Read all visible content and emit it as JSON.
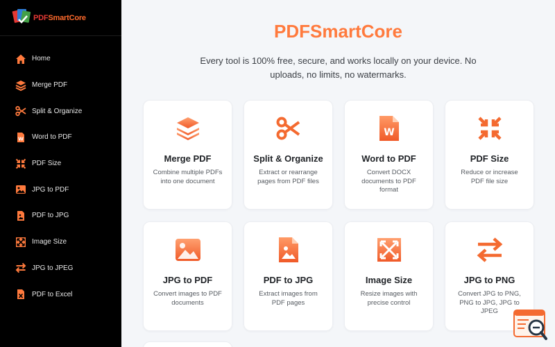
{
  "brand": {
    "name_part1": "PDF",
    "name_part2": "SmartCore"
  },
  "nav": [
    {
      "label": "Home",
      "icon": "home-icon"
    },
    {
      "label": "Merge PDF",
      "icon": "layers-icon"
    },
    {
      "label": "Split & Organize",
      "icon": "scissors-icon"
    },
    {
      "label": "Word to PDF",
      "icon": "word-file-icon"
    },
    {
      "label": "PDF Size",
      "icon": "compress-icon"
    },
    {
      "label": "JPG to PDF",
      "icon": "image-icon"
    },
    {
      "label": "PDF to JPG",
      "icon": "image-file-icon"
    },
    {
      "label": "Image Size",
      "icon": "expand-icon"
    },
    {
      "label": "JPG to JPEG",
      "icon": "swap-icon"
    },
    {
      "label": "PDF to Excel",
      "icon": "excel-file-icon"
    }
  ],
  "main": {
    "title": "PDFSmartCore",
    "subtitle": "Every tool is 100% free, secure, and works locally on your device. No uploads, no limits, no watermarks."
  },
  "cards": [
    {
      "title": "Merge PDF",
      "desc": "Combine multiple PDFs into one document",
      "icon": "layers-icon"
    },
    {
      "title": "Split & Organize",
      "desc": "Extract or rearrange pages from PDF files",
      "icon": "scissors-icon"
    },
    {
      "title": "Word to PDF",
      "desc": "Convert DOCX documents to PDF format",
      "icon": "word-file-icon"
    },
    {
      "title": "PDF Size",
      "desc": "Reduce or increase PDF file size",
      "icon": "compress-icon"
    },
    {
      "title": "JPG to PDF",
      "desc": "Convert images to PDF documents",
      "icon": "image-icon"
    },
    {
      "title": "PDF to JPG",
      "desc": "Extract images from PDF pages",
      "icon": "image-file-icon"
    },
    {
      "title": "Image Size",
      "desc": "Resize images with precise control",
      "icon": "expand-icon"
    },
    {
      "title": "JPG to PNG",
      "desc": "Convert JPG to PNG, PNG to JPG, JPG to JPEG",
      "icon": "swap-icon"
    }
  ],
  "colors": {
    "accent": "#ff7a3d",
    "accent_dark": "#f0622a",
    "sidebar_bg": "#000000",
    "page_bg": "#f4f6f9"
  }
}
